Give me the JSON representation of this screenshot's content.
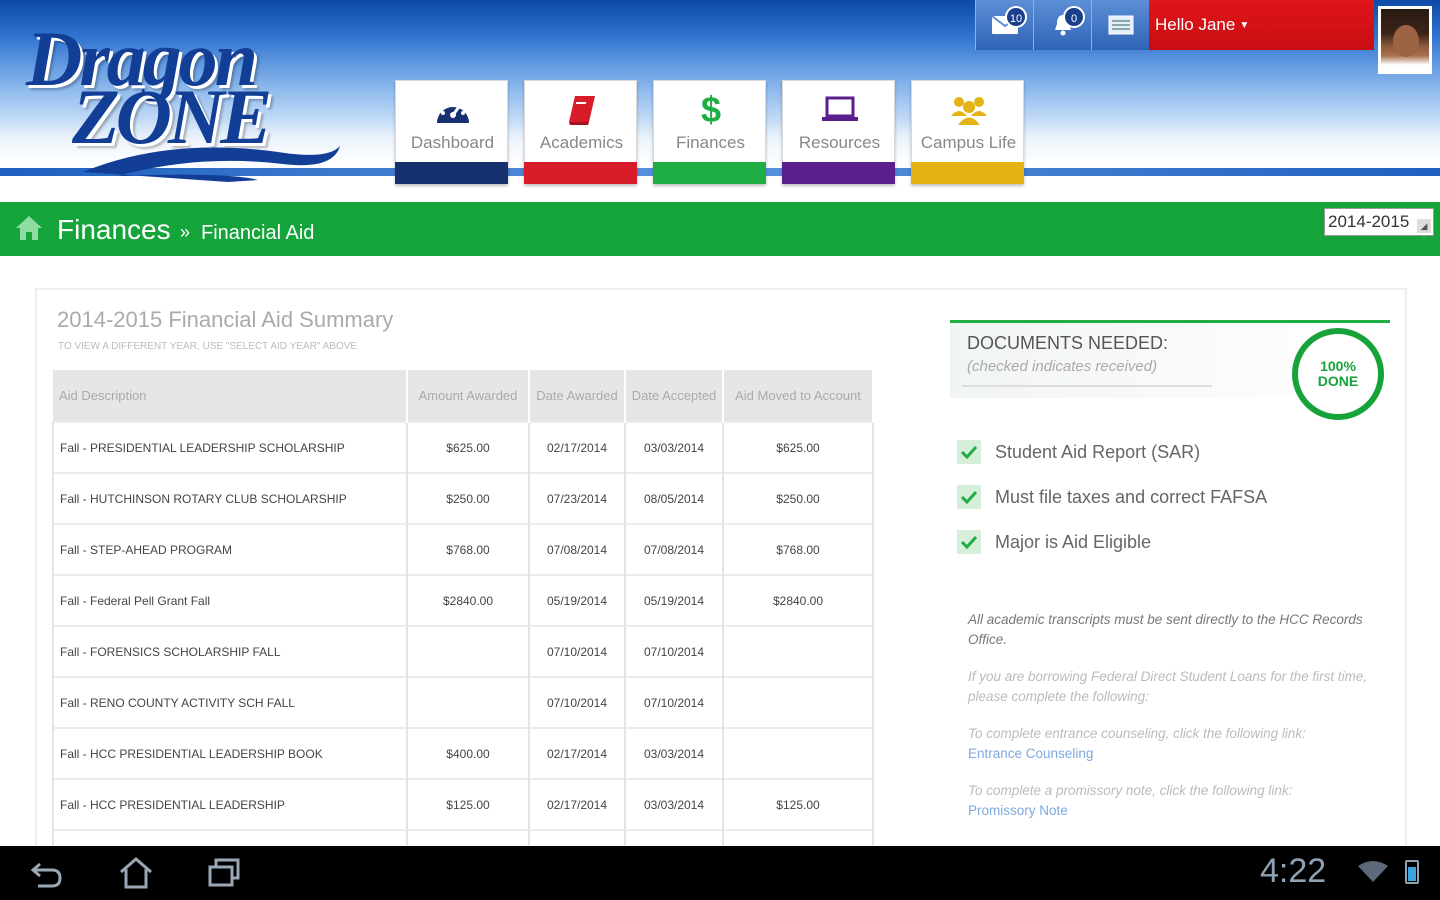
{
  "header": {
    "logo_line1": "Dragon",
    "logo_line2": "ZONE",
    "messages_count": "10",
    "notifications_count": "0",
    "greeting": "Hello Jane"
  },
  "nav": {
    "tabs": [
      {
        "label": "Dashboard",
        "icon": "dashboard-gauge-icon",
        "color": "#17306f"
      },
      {
        "label": "Academics",
        "icon": "book-icon",
        "color": "#d81c2a"
      },
      {
        "label": "Finances",
        "icon": "dollar-icon",
        "color": "#1fae44"
      },
      {
        "label": "Resources",
        "icon": "laptop-icon",
        "color": "#5a1f8c"
      },
      {
        "label": "Campus Life",
        "icon": "people-icon",
        "color": "#e4b414"
      }
    ]
  },
  "breadcrumb": {
    "section": "Finances",
    "separator": "»",
    "page": "Financial Aid",
    "year_selected": "2014-2015"
  },
  "summary": {
    "title": "2014-2015 Financial Aid Summary",
    "subtitle": "To view a different year, use \"Select Aid Year\" above",
    "columns": [
      "Aid Description",
      "Amount Awarded",
      "Date Awarded",
      "Date Accepted",
      "Aid Moved to Account"
    ],
    "rows": [
      [
        "Fall - PRESIDENTIAL LEADERSHIP SCHOLARSHIP",
        "$625.00",
        "02/17/2014",
        "03/03/2014",
        "$625.00"
      ],
      [
        "Fall - HUTCHINSON ROTARY CLUB SCHOLARSHIP",
        "$250.00",
        "07/23/2014",
        "08/05/2014",
        "$250.00"
      ],
      [
        "Fall - STEP-AHEAD PROGRAM",
        "$768.00",
        "07/08/2014",
        "07/08/2014",
        "$768.00"
      ],
      [
        "Fall - Federal Pell Grant Fall",
        "$2840.00",
        "05/19/2014",
        "05/19/2014",
        "$2840.00"
      ],
      [
        "Fall - FORENSICS SCHOLARSHIP FALL",
        "",
        "07/10/2014",
        "07/10/2014",
        ""
      ],
      [
        "Fall - RENO COUNTY ACTIVITY SCH FALL",
        "",
        "07/10/2014",
        "07/10/2014",
        ""
      ],
      [
        "Fall - HCC PRESIDENTIAL LEADERSHIP BOOK",
        "$400.00",
        "02/17/2014",
        "03/03/2014",
        ""
      ],
      [
        "Fall - HCC PRESIDENTIAL LEADERSHIP",
        "$125.00",
        "02/17/2014",
        "03/03/2014",
        "$125.00"
      ]
    ]
  },
  "documents": {
    "title": "DOCUMENTS NEEDED:",
    "subtitle": "(checked indicates received)",
    "progress_label": "100% DONE",
    "progress_percent": 100,
    "items": [
      {
        "label": "Student Aid Report (SAR)",
        "checked": true
      },
      {
        "label": "Must file taxes and correct FAFSA",
        "checked": true
      },
      {
        "label": "Major is Aid Eligible",
        "checked": true
      }
    ],
    "note1": "All academic transcripts must be sent directly to the HCC Records Office.",
    "note2": "If you are borrowing Federal Direct Student Loans for the first time, please complete the following:",
    "note3": "To complete entrance counseling, click the following link:",
    "link1": "Entrance Counseling",
    "note4": "To complete a promissory note, click the following link:",
    "link2": "Promissory Note"
  },
  "system_bar": {
    "time": "4:22"
  }
}
